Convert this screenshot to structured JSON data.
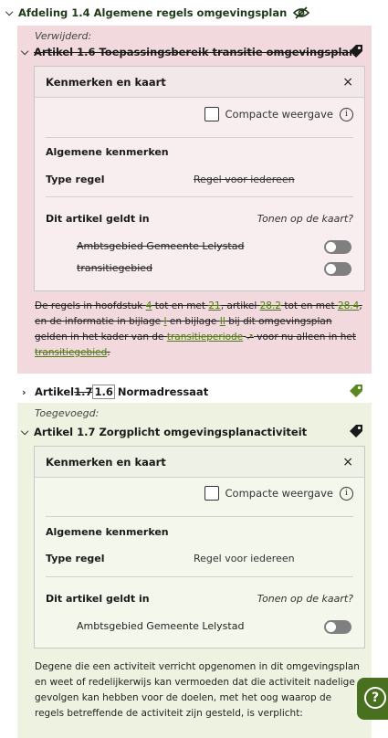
{
  "afdeling": {
    "title": "Afdeling 1.4 Algemene regels omgevingsplan"
  },
  "removed": {
    "status": "Verwijderd:",
    "article_title": "Artikel 1.6 Toepassingsbereik transitie omgevingsplan",
    "card": {
      "title": "Kenmerken en kaart",
      "close": "×",
      "compact_label": "Compacte weergave",
      "section_title": "Algemene kenmerken",
      "type_label": "Type regel",
      "type_value": "Regel voor iedereen",
      "applies_label": "Dit artikel geldt in",
      "map_label": "Tonen op de kaart?",
      "locations": [
        "Ambtsgebied Gemeente Lelystad",
        "transitiegebied"
      ]
    },
    "body": {
      "t1": "De regels in hoofdstuk ",
      "l1": "4",
      "t2": " tot en met ",
      "l2": "21",
      "t3": ", artikel ",
      "l3": "28.2",
      "t4": " tot en met ",
      "l4": "28.4",
      "t5": ", en de informatie in bijlage ",
      "l5": "I",
      "t6": " en bijlage ",
      "l6": "II",
      "t7": " bij dit omgevingsplan gelden in het kader van de ",
      "l7": "transitieperiode",
      "t8": " voor nu alleen in het ",
      "l8": "transitiegebied",
      "t9": "."
    }
  },
  "collapsed": {
    "prefix": "Artikel ",
    "old_number": "1.7",
    "new_number": "1.6",
    "name": "Normadressaat"
  },
  "added": {
    "status": "Toegevoegd:",
    "article_title": "Artikel 1.7 Zorgplicht omgevingsplanactiviteit",
    "card": {
      "title": "Kenmerken en kaart",
      "close": "×",
      "compact_label": "Compacte weergave",
      "section_title": "Algemene kenmerken",
      "type_label": "Type regel",
      "type_value": "Regel voor iedereen",
      "applies_label": "Dit artikel geldt in",
      "map_label": "Tonen op de kaart?",
      "locations": [
        "Ambtsgebied Gemeente Lelystad"
      ]
    },
    "body": "Degene die een activiteit verricht opgenomen in dit omgevingsplan en weet of redelijkerwijs kan vermoeden dat die activiteit nadelige gevolgen kan hebben voor de doelen, met het oog waarop de regels betreffende de activiteit zijn gesteld, is verplicht:"
  },
  "help": {
    "symbol": "?"
  },
  "colors": {
    "removed_bg": "#f2d9dd",
    "added_bg": "#eef3e1",
    "link_green": "#4e7a14",
    "tag_green": "#5a8a1f"
  },
  "icons": [
    "chevron-down-icon",
    "eye-slash-icon",
    "tag-icon",
    "close-icon",
    "info-icon",
    "external-link-icon",
    "chevron-right-icon",
    "help-icon"
  ]
}
